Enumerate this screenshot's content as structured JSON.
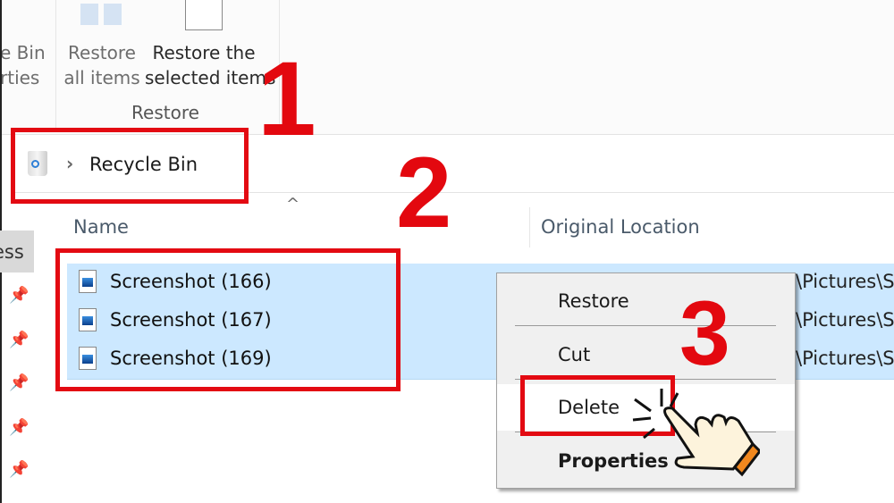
{
  "ribbon": {
    "partial_button": [
      "e Bin",
      "rties"
    ],
    "restore_all": [
      "Restore",
      "all items"
    ],
    "restore_selected": [
      "Restore the",
      "selected items"
    ],
    "group_label": "Restore"
  },
  "address": {
    "icon": "recycle-bin-icon",
    "path": "Recycle Bin"
  },
  "sidebar": {
    "partial_item": "ess",
    "pins": 5
  },
  "columns": {
    "name": "Name",
    "original_location": "Original Location"
  },
  "files": [
    {
      "name": "Screenshot (166)",
      "location": "\\Pictures\\S"
    },
    {
      "name": "Screenshot (167)",
      "location": "\\Pictures\\S"
    },
    {
      "name": "Screenshot (169)",
      "location": "\\Pictures\\S"
    }
  ],
  "context_menu": {
    "items": [
      "Restore",
      "Cut",
      "Delete",
      "Properties"
    ]
  },
  "steps": [
    "1",
    "2",
    "3"
  ],
  "colors": {
    "annotation": "#e30a12",
    "selection": "#cce8ff"
  }
}
